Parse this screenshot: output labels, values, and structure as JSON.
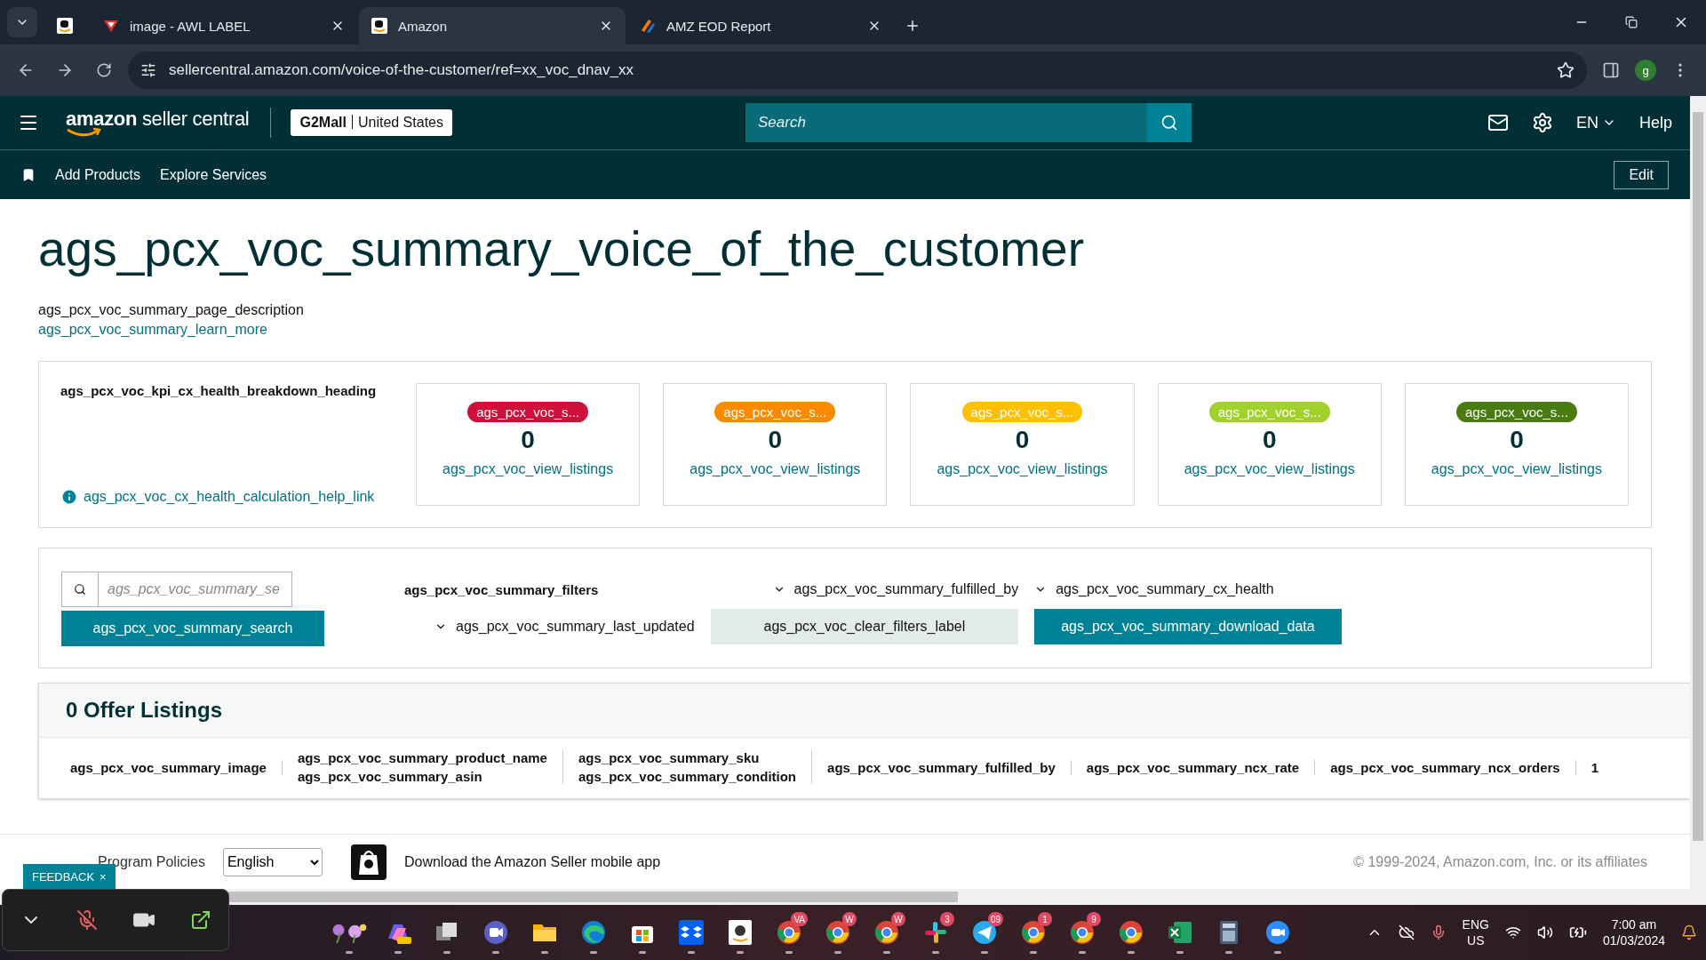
{
  "browser": {
    "tabs": [
      {
        "kind": "amazon",
        "selected": false
      },
      {
        "kind": "label",
        "title": "image - AWL LABEL",
        "selected": false
      },
      {
        "kind": "amazon",
        "title": "Amazon",
        "selected": true
      },
      {
        "kind": "report",
        "title": "AMZ EOD Report",
        "selected": false
      }
    ],
    "url": "sellercentral.amazon.com/voice-of-the-customer/ref=xx_voc_dnav_xx",
    "profile": "g"
  },
  "header": {
    "logo_brand": "amazon",
    "logo_product": "seller central",
    "store": "G2Mall",
    "region": "United States",
    "search_placeholder": "Search",
    "language": "EN",
    "help": "Help"
  },
  "subnav": {
    "items": [
      "Add Products",
      "Explore Services"
    ],
    "edit": "Edit"
  },
  "page": {
    "title": "ags_pcx_voc_summary_voice_of_the_customer",
    "description": "ags_pcx_voc_summary_page_description",
    "learn_more": "ags_pcx_voc_summary_learn_more"
  },
  "kpi": {
    "heading": "ags_pcx_voc_kpi_cx_health_breakdown_heading",
    "help_link": "ags_pcx_voc_cx_health_calculation_help_link",
    "cards": [
      {
        "chip": "ags_pcx_voc_s...",
        "color": "#d0103a",
        "count": "0",
        "link": "ags_pcx_voc_view_listings"
      },
      {
        "chip": "ags_pcx_voc_s...",
        "color": "#fa8a00",
        "count": "0",
        "link": "ags_pcx_voc_view_listings"
      },
      {
        "chip": "ags_pcx_voc_s...",
        "color": "#ffc000",
        "count": "0",
        "link": "ags_pcx_voc_view_listings"
      },
      {
        "chip": "ags_pcx_voc_s...",
        "color": "#a3d12b",
        "count": "0",
        "link": "ags_pcx_voc_view_listings"
      },
      {
        "chip": "ags_pcx_voc_s...",
        "color": "#4a7a12",
        "count": "0",
        "link": "ags_pcx_voc_view_listings"
      }
    ]
  },
  "filters": {
    "search_placeholder": "ags_pcx_voc_summary_se",
    "search_button": "ags_pcx_voc_summary_search",
    "label": "ags_pcx_voc_summary_filters",
    "dropdowns": [
      "ags_pcx_voc_summary_fulfilled_by",
      "ags_pcx_voc_summary_cx_health",
      "ags_pcx_voc_summary_last_updated"
    ],
    "clear": "ags_pcx_voc_clear_filters_label",
    "download": "ags_pcx_voc_summary_download_data"
  },
  "listings": {
    "title": "0 Offer Listings",
    "columns": [
      {
        "lines": [
          "ags_pcx_voc_summary_image"
        ]
      },
      {
        "lines": [
          "ags_pcx_voc_summary_product_name",
          "ags_pcx_voc_summary_asin"
        ]
      },
      {
        "lines": [
          "ags_pcx_voc_summary_sku",
          "ags_pcx_voc_summary_condition"
        ]
      },
      {
        "lines": [
          "ags_pcx_voc_summary_fulfilled_by"
        ]
      },
      {
        "lines": [
          "ags_pcx_voc_summary_ncx_rate"
        ]
      },
      {
        "lines": [
          "ags_pcx_voc_summary_ncx_orders"
        ]
      },
      {
        "lines": [
          "1"
        ]
      }
    ]
  },
  "footer": {
    "link": "Program Policies",
    "language": "English",
    "app_text": "Download the Amazon Seller mobile app",
    "copyright": "© 1999-2024, Amazon.com, Inc. or its affiliates"
  },
  "feedback": {
    "label": "FEEDBACK",
    "close": "×"
  },
  "taskbar": {
    "apps": [
      {
        "kind": "flower"
      },
      {
        "kind": "copilot"
      },
      {
        "kind": "windows"
      },
      {
        "kind": "video"
      },
      {
        "kind": "folder"
      },
      {
        "kind": "edge"
      },
      {
        "kind": "store"
      },
      {
        "kind": "dropbox"
      },
      {
        "kind": "amazon"
      },
      {
        "kind": "chrome",
        "badge": "VA"
      },
      {
        "kind": "chrome",
        "badge": "W"
      },
      {
        "kind": "chrome",
        "badge": "W"
      },
      {
        "kind": "slack",
        "badge": "3"
      },
      {
        "kind": "telegram",
        "badge": "09"
      },
      {
        "kind": "chrome",
        "badge": "1"
      },
      {
        "kind": "chrome",
        "badge": "9"
      },
      {
        "kind": "chrome"
      },
      {
        "kind": "excel"
      },
      {
        "kind": "calculator"
      },
      {
        "kind": "zoom"
      }
    ],
    "lang": "ENG",
    "region": "US",
    "time": "7:00 am",
    "date": "01/03/2024"
  }
}
